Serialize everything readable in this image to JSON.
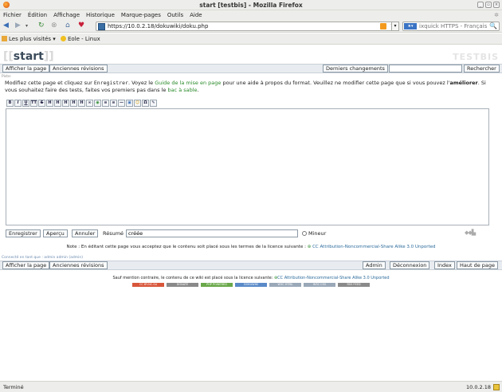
{
  "window": {
    "title": "start [testbis] - Mozilla Firefox",
    "buttons": [
      "_",
      "▫",
      "×"
    ]
  },
  "menu": [
    "Fichier",
    "Édition",
    "Affichage",
    "Historique",
    "Marque-pages",
    "Outils",
    "Aide"
  ],
  "nav": {
    "url": "https://10.0.2.18/dokuwiki/doku.php",
    "search_placeholder": "ixquick HTTPS - Français"
  },
  "bookmarks": [
    "Les plus visités",
    "Eole - Linux"
  ],
  "page": {
    "title_open": "[[",
    "title": "start",
    "title_close": "]]",
    "wiki_name": "TESTBIS",
    "top_actions": {
      "show_page": "Afficher la page",
      "old_revisions": "Anciennes révisions",
      "recent_changes": "Derniers changements",
      "search_button": "Rechercher"
    },
    "trace": "Piste:",
    "intro": {
      "p1": "Modifiez cette page et cliquez sur ",
      "save_word": "Enregistrer",
      "p2": ". Voyez le ",
      "guide_link": "Guide de la mise en page",
      "p3": " pour une aide à propos du format. Veuillez ne modifier cette page que si vous pouvez l'",
      "improve": "améliorer",
      "p4": ". Si vous souhaitez faire des tests, faites vos premiers pas dans le ",
      "sandbox_link": "bac à sable",
      "p5": "."
    },
    "toolbar": [
      "B",
      "I",
      "U",
      "TT",
      "S",
      "H",
      "H",
      "H",
      "H",
      "H",
      "∞",
      "◉",
      "≡",
      "≡",
      "—",
      "▣",
      "☺",
      "Ω",
      "✎"
    ],
    "editor_value": "",
    "edit_row": {
      "save": "Enregistrer",
      "preview": "Aperçu",
      "cancel": "Annuler",
      "summary_label": "Résumé",
      "summary_value": "créée",
      "minor": "Mineur"
    },
    "license_note": {
      "text": "Note : En éditant cette page vous acceptez que le contenu soit placé sous les termes de la licence suivante : ",
      "link": "CC Attribution-Noncommercial-Share Alike 3.0 Unported"
    },
    "logged_in": "Connecté en tant que : admin admin (admin)",
    "bottom_actions": {
      "show_page": "Afficher la page",
      "old_revisions": "Anciennes révisions",
      "admin": "Admin",
      "logout": "Déconnexion",
      "index": "Index",
      "top": "Haut de page"
    },
    "footer_license": {
      "text": "Sauf mention contraire, le contenu de ce wiki est placé sous la licence suivante: ",
      "link": "CC Attribution-Noncommercial-Share Alike 3.0 Unported"
    },
    "badges": [
      "CC BY-NC-SA",
      "DONATE",
      "PHP POWERED",
      "DOKUWIKI",
      "W3C HTML",
      "W3C CSS",
      "RSS FEED"
    ]
  },
  "status": {
    "text": "Terminé",
    "host": "10.0.2.18"
  },
  "colors": {
    "link_green": "#2a8a2a",
    "link_blue": "#2a6a9a",
    "chrome": "#ededeb"
  }
}
